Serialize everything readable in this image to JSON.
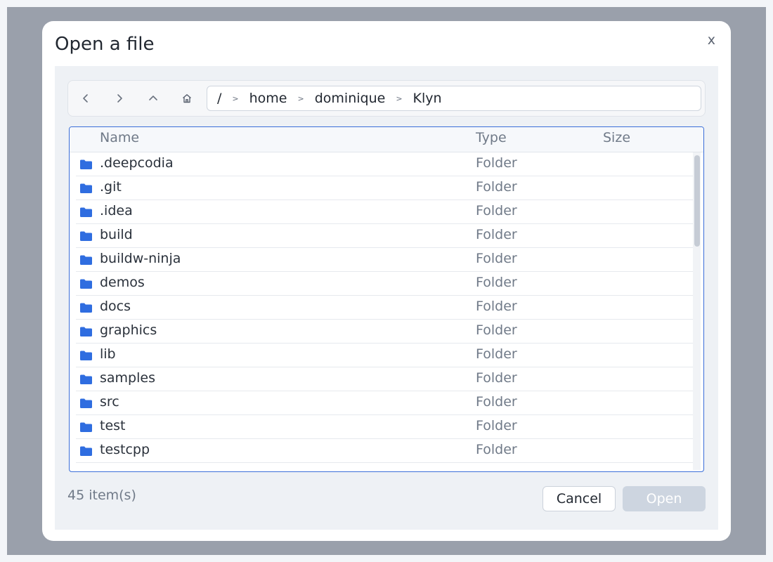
{
  "dialog": {
    "title": "Open a file",
    "close_label": "x"
  },
  "nav": {
    "back_icon": "chevron-left-icon",
    "forward_icon": "chevron-right-icon",
    "up_icon": "chevron-up-icon",
    "home_icon": "home-icon",
    "breadcrumb": [
      "/",
      "home",
      "dominique",
      "Klyn"
    ],
    "separator": ">"
  },
  "table": {
    "columns": [
      "Name",
      "Type",
      "Size"
    ],
    "rows": [
      {
        "name": ".deepcodia",
        "type": "Folder",
        "size": ""
      },
      {
        "name": ".git",
        "type": "Folder",
        "size": ""
      },
      {
        "name": ".idea",
        "type": "Folder",
        "size": ""
      },
      {
        "name": "build",
        "type": "Folder",
        "size": ""
      },
      {
        "name": "buildw-ninja",
        "type": "Folder",
        "size": ""
      },
      {
        "name": "demos",
        "type": "Folder",
        "size": ""
      },
      {
        "name": "docs",
        "type": "Folder",
        "size": ""
      },
      {
        "name": "graphics",
        "type": "Folder",
        "size": ""
      },
      {
        "name": "lib",
        "type": "Folder",
        "size": ""
      },
      {
        "name": "samples",
        "type": "Folder",
        "size": ""
      },
      {
        "name": "src",
        "type": "Folder",
        "size": ""
      },
      {
        "name": "test",
        "type": "Folder",
        "size": ""
      },
      {
        "name": "testcpp",
        "type": "Folder",
        "size": ""
      }
    ],
    "row_icon": "folder-icon"
  },
  "footer": {
    "item_count": "45 item(s)",
    "cancel_label": "Cancel",
    "open_label": "Open"
  },
  "colors": {
    "accent": "#3b6fd9",
    "folder": "#2f6de0",
    "open_disabled": "#cdd5e0"
  }
}
